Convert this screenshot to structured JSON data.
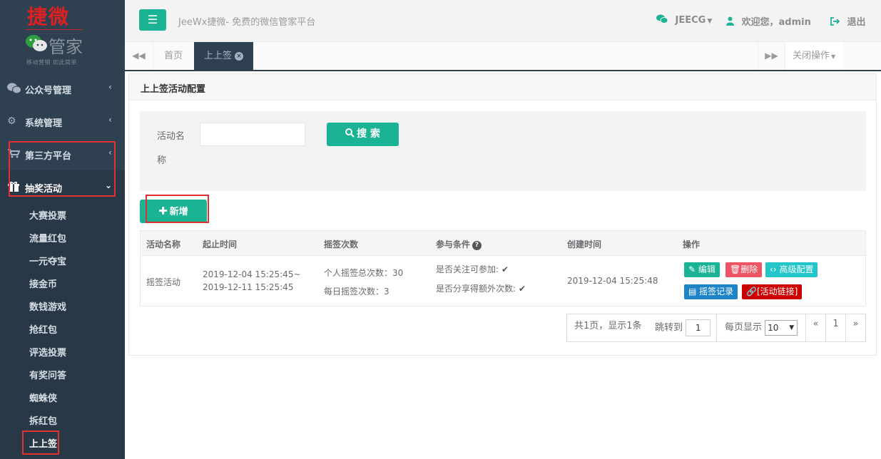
{
  "logo": {
    "title": "捷微",
    "subtitle": "管家",
    "tagline": "移动营销  如此简单"
  },
  "sidebar": {
    "items": [
      {
        "label": "公众号管理",
        "icon": "wechat-icon"
      },
      {
        "label": "系统管理",
        "icon": "gear-icon"
      },
      {
        "label": "第三方平台",
        "icon": "cart-icon"
      },
      {
        "label": "抽奖活动",
        "icon": "gift-icon",
        "expanded": true
      }
    ],
    "subitems": [
      "大赛投票",
      "流量红包",
      "一元夺宝",
      "接金币",
      "数钱游戏",
      "抢红包",
      "评选投票",
      "有奖问答",
      "蜘蛛侠",
      "拆红包",
      "上上签"
    ],
    "active_subitem": "上上签"
  },
  "header": {
    "title": "JeeWx捷微- 免费的微信管家平台",
    "brand_label": "JEECG",
    "welcome": "欢迎您，admin",
    "logout": "退出"
  },
  "tabs": {
    "items": [
      {
        "label": "首页"
      },
      {
        "label": "上上签",
        "active": true
      }
    ],
    "close_ops": "关闭操作"
  },
  "panel": {
    "title": "上上签活动配置"
  },
  "search": {
    "label_line1": "活动名",
    "label_line2": "称",
    "input_value": "",
    "button": "搜 索"
  },
  "actions": {
    "add": "新增"
  },
  "table": {
    "headers": [
      "活动名称",
      "起止时间",
      "摇签次数",
      "参与条件",
      "创建时间",
      "操作"
    ],
    "rows": [
      {
        "name": "摇签活动",
        "start": "2019-12-04 15:25:45~",
        "end": "2019-12-11 15:25:45",
        "count_total": "个人摇签总次数：30",
        "count_daily": "每日摇签次数：3",
        "cond_follow": "是否关注可参加:",
        "cond_share": "是否分享得额外次数:",
        "created": "2019-12-04 15:25:48",
        "ops": {
          "edit": "编辑",
          "delete": "删除",
          "advanced": "高级配置",
          "records": "摇签记录",
          "link": "[活动链接]"
        }
      }
    ]
  },
  "pager": {
    "summary": "共1页，显示1条",
    "jump_label": "跳转到",
    "jump_value": "1",
    "per_page_label": "每页显示",
    "per_page_value": "10",
    "prev": "«",
    "page": "1",
    "next": "»"
  },
  "colors": {
    "accent": "#1ab394",
    "sidebar": "#2f4050",
    "highlight_box": "#e03030"
  }
}
